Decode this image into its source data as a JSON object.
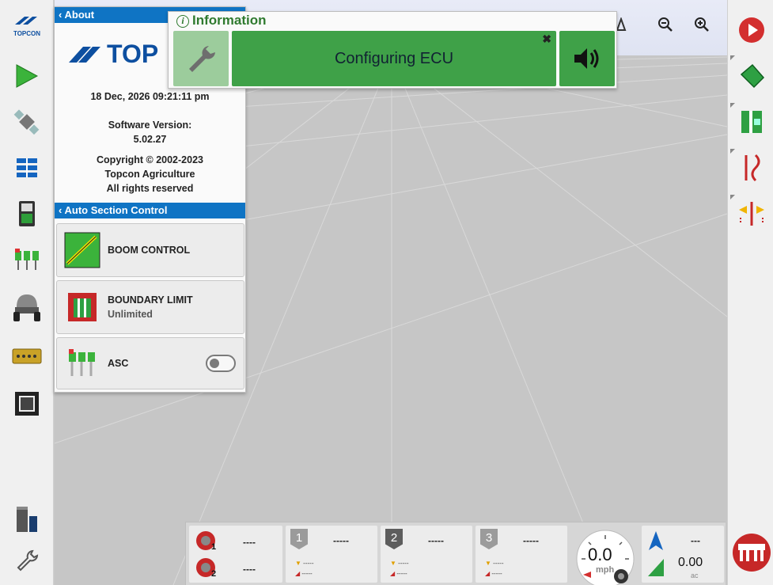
{
  "about_panel": {
    "header": "About",
    "logo_text": "TOP",
    "datetime": "18 Dec, 2026  09:21:11 pm",
    "software_version_label": "Software Version:",
    "software_version": "5.02.27",
    "copyright": "Copyright © 2002-2023",
    "company": "Topcon Agriculture",
    "rights": "All rights reserved"
  },
  "asc_panel": {
    "header": "Auto Section Control",
    "boom_control_label": "BOOM CONTROL",
    "boundary_limit_label": "BOUNDARY LIMIT",
    "boundary_limit_value": "Unlimited",
    "asc_label": "ASC",
    "asc_enabled": false
  },
  "info_dialog": {
    "title": "Information",
    "message": "Configuring ECU",
    "close_glyph": "✖"
  },
  "leftbar": {
    "brand": "TOPCON"
  },
  "status_bar": {
    "wheel1_value": "----",
    "wheel2_value": "----",
    "product1_label": "1",
    "product1_value": "-----",
    "product1_sub1": "-----",
    "product1_sub2": "-----",
    "product2_label": "2",
    "product2_value": "-----",
    "product2_sub1": "-----",
    "product2_sub2": "-----",
    "product3_label": "3",
    "product3_value": "-----",
    "product3_sub1": "-----",
    "product3_sub2": "-----",
    "speed_value": "0.0",
    "speed_unit": "mph",
    "heading_value": "---",
    "area_value": "0.00",
    "area_unit": "ac"
  },
  "colors": {
    "accent_blue": "#0f74c4",
    "status_green": "#3fa148",
    "record_red": "#d32f2f"
  },
  "icons": {
    "leftbar": [
      "topcon-logo-icon",
      "guidance-arrow-icon",
      "gnss-satellite-icon",
      "section-bars-icon",
      "console-icon",
      "section-switches-icon",
      "implement-icon",
      "harness-icon",
      "display-icon",
      "bin-icon",
      "wrench-icon"
    ],
    "rightbar": [
      "record-icon",
      "field-boundary-icon",
      "headland-icon",
      "guideline-icon",
      "nudge-icon",
      "implement-bar-icon"
    ]
  }
}
